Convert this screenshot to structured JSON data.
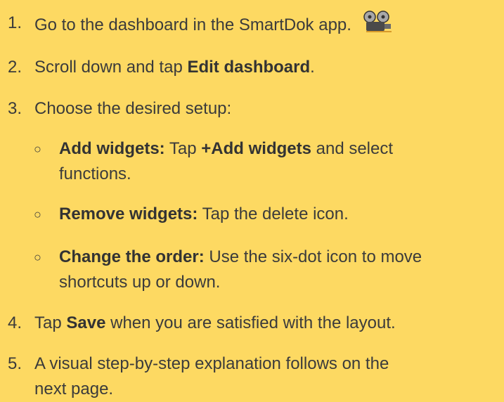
{
  "steps": [
    {
      "num": "1.",
      "text": "Go to the dashboard in the SmartDok app.",
      "icon": "film-projector-icon"
    },
    {
      "num": "2.",
      "pre": "Scroll down and tap ",
      "bold": "Edit dashboard",
      "post": "."
    },
    {
      "num": "3.",
      "text": "Choose the desired setup:"
    },
    {
      "num": "4.",
      "pre": "Tap ",
      "bold": "Save",
      "post": " when you are satisfied with the layout."
    },
    {
      "num": "5.",
      "line1": "A visual step-by-step explanation follows on the",
      "line2": "next page."
    }
  ],
  "substeps": [
    {
      "bullet": "○",
      "bold": "Add widgets:",
      "pre": " Tap ",
      "bold2": "+Add widgets",
      "post": " and select",
      "line2": "functions."
    },
    {
      "bullet": "○",
      "bold": "Remove widgets:",
      "pre": " Tap the delete icon."
    },
    {
      "bullet": "○",
      "bold": "Change the order:",
      "pre": " Use the six-dot icon to move",
      "line2": "shortcuts up or down."
    }
  ],
  "colors": {
    "background": "#FDD962",
    "text": "#3B3B3B"
  }
}
